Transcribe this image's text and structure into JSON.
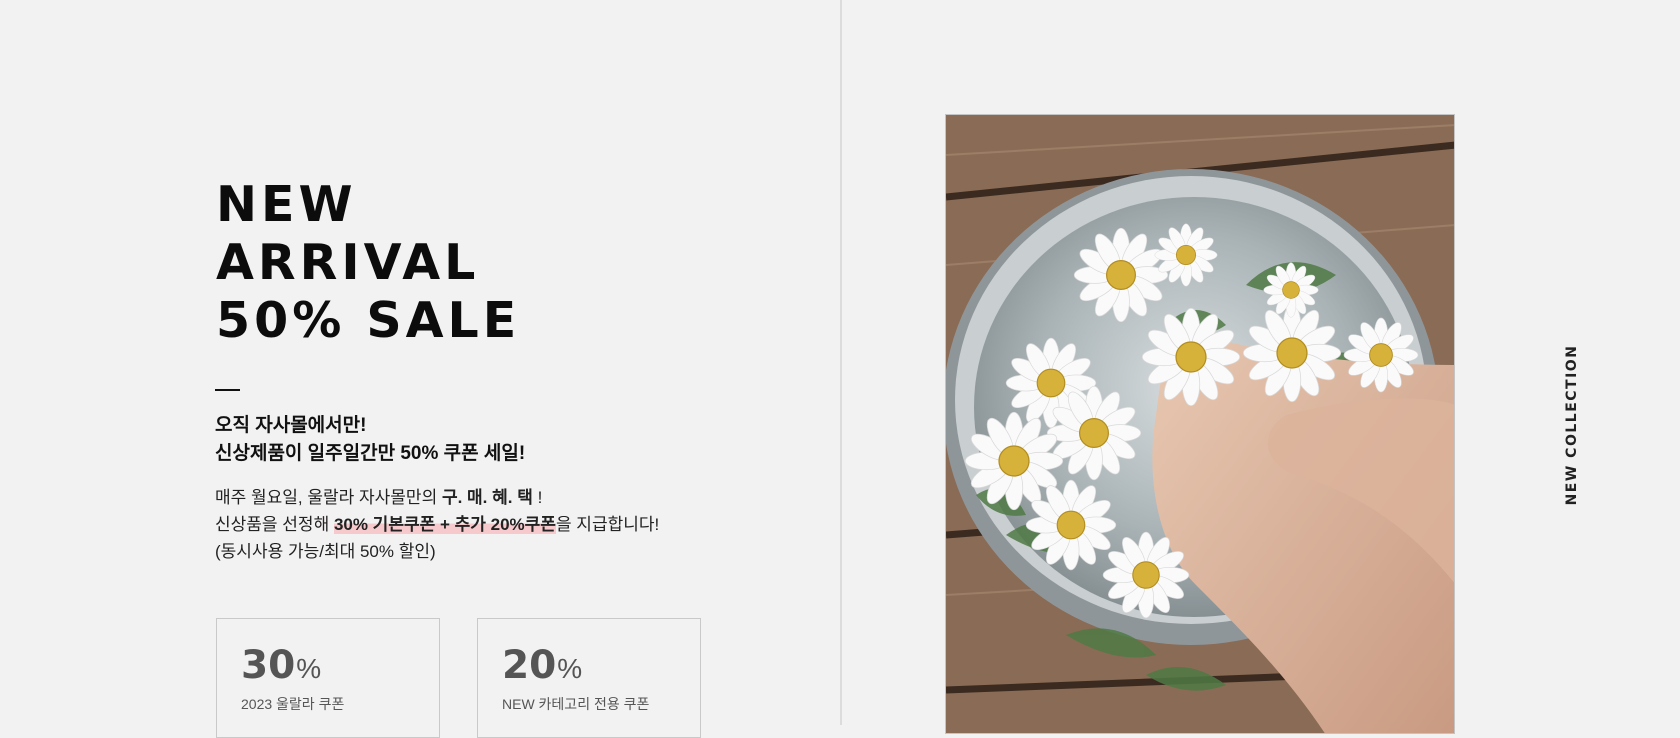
{
  "hero": {
    "headline_lines": [
      "NEW",
      "ARRIVAL",
      "50% SALE"
    ],
    "sub_lines": [
      "오직 자사몰에서만!",
      "신상제품이 일주일간만 50% 쿠폰 세일!"
    ],
    "desc": {
      "line1_prefix": "매주 월요일, 울랄라 자사몰만의 ",
      "line1_bold": "구. 매. 혜. 택",
      "line1_suffix": " !",
      "line2_prefix": "신상품을 선정해 ",
      "line2_highlight": "30% 기본쿠폰 + 추가 20%쿠폰",
      "line2_suffix": "을 지급합니다!",
      "line3": "(동시사용 가능/최대 50% 할인)"
    }
  },
  "coupons": [
    {
      "amount": "30",
      "unit": "%",
      "label": "2023 울랄라 쿠폰"
    },
    {
      "amount": "20",
      "unit": "%",
      "label": "NEW 카테고리 전용 쿠폰"
    }
  ],
  "side_label": "NEW COLLECTION",
  "colors": {
    "background": "#f2f2f2",
    "highlight": "#f6c9cc",
    "text": "#111111"
  }
}
